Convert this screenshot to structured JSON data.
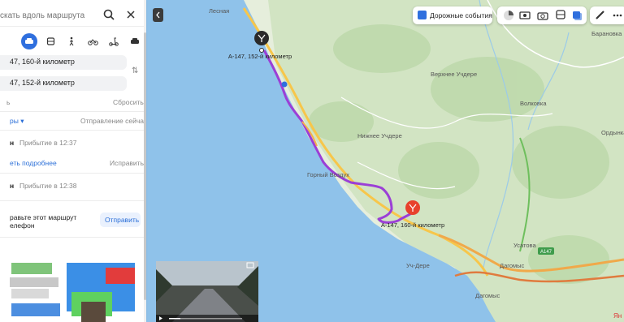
{
  "search": {
    "placeholder": "скать вдоль маршрута"
  },
  "route": {
    "from": "47, 160-й километр",
    "to": "47, 152-й километр",
    "left_label": "ь",
    "reset": "Сбросить",
    "options": "ры ▾",
    "departure": "Отправление сейчас"
  },
  "routes": [
    {
      "prefix": "н",
      "arrival": "Прибытие в 12:37",
      "more": "еть подробнее",
      "fix": "Исправить"
    },
    {
      "prefix": "н",
      "arrival": "Прибытие в 12:38"
    }
  ],
  "send_block": {
    "line1": "равьте этот маршрут",
    "line2": "елефон",
    "button": "Отправить"
  },
  "toolbar": {
    "traffic_label": "Дорожные события"
  },
  "map": {
    "places": [
      "Лесная",
      "Верхнее Учдере",
      "Волковка",
      "Нижнее Учдере",
      "Горный Воздух",
      "Уч-Дере",
      "Дагомыс",
      "Дагомыс",
      "Усатова",
      "Барановка",
      "Ордынка"
    ],
    "markers": {
      "start": "А-147, 152-й километр",
      "end": "А-147, 160-й километр"
    },
    "road_badge": "А147",
    "corner": "Ян"
  },
  "colors": {
    "sea": "#8fc2ea",
    "route": "#9b3fd6",
    "active_mode": "#2f6fde",
    "end_marker": "#e8412c"
  }
}
